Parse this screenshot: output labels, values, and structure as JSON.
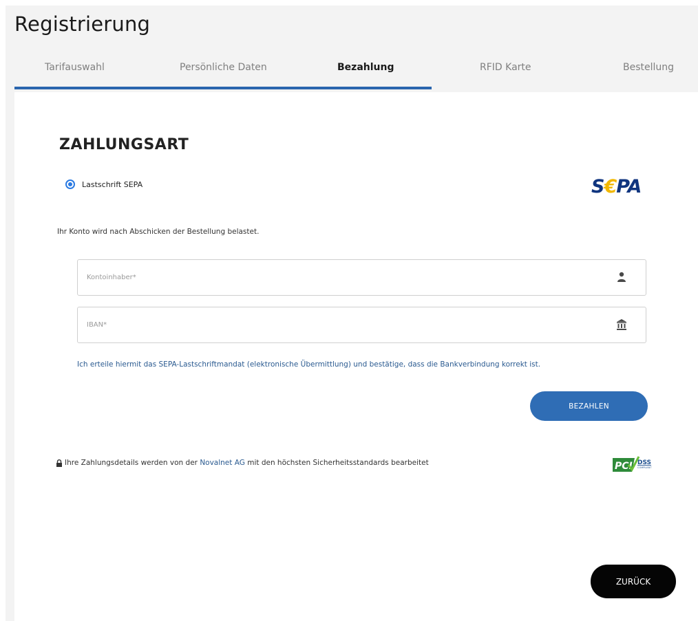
{
  "header": {
    "title": "Registrierung"
  },
  "tabs": [
    {
      "label": "Tarifauswahl"
    },
    {
      "label": "Persönliche Daten"
    },
    {
      "label": "Bezahlung"
    },
    {
      "label": "RFID Karte"
    },
    {
      "label": "Bestellung"
    }
  ],
  "progress": {
    "active_step": 3,
    "total_steps": 5
  },
  "payment": {
    "heading": "ZAHLUNGSART",
    "method_label": "Lastschrift SEPA",
    "method_selected": true,
    "sepa_logo": {
      "text_s": "S",
      "text_euro": "€",
      "text_pa": "PA"
    },
    "info": "Ihr Konto wird nach Abschicken der Bestellung belastet.",
    "account_holder": {
      "placeholder": "Kontoinhaber*",
      "value": "",
      "icon": "user-icon"
    },
    "iban": {
      "placeholder": "IBAN*",
      "value": "",
      "icon": "bank-icon"
    },
    "mandate": "Ich erteile hiermit das SEPA-Lastschriftmandat (elektronische Übermittlung) und bestätige, dass die Bankverbindung korrekt ist.",
    "pay_label": "BEZAHLEN"
  },
  "security": {
    "prefix": "Ihre Zahlungsdetails werden von der",
    "link": "Novalnet AG",
    "suffix": "mit den höchsten Sicherheitsstandards bearbeitet",
    "pci_text": "PCI",
    "dss_text": "DSS",
    "compliant_text": "COMPLIANT"
  },
  "footer": {
    "back_label": "ZURÜCK"
  },
  "colors": {
    "accent": "#2a65ad",
    "button": "#2f6db5",
    "sepa_blue": "#10357f",
    "sepa_gold": "#f2b800",
    "pci_green": "#2e8b3a"
  }
}
